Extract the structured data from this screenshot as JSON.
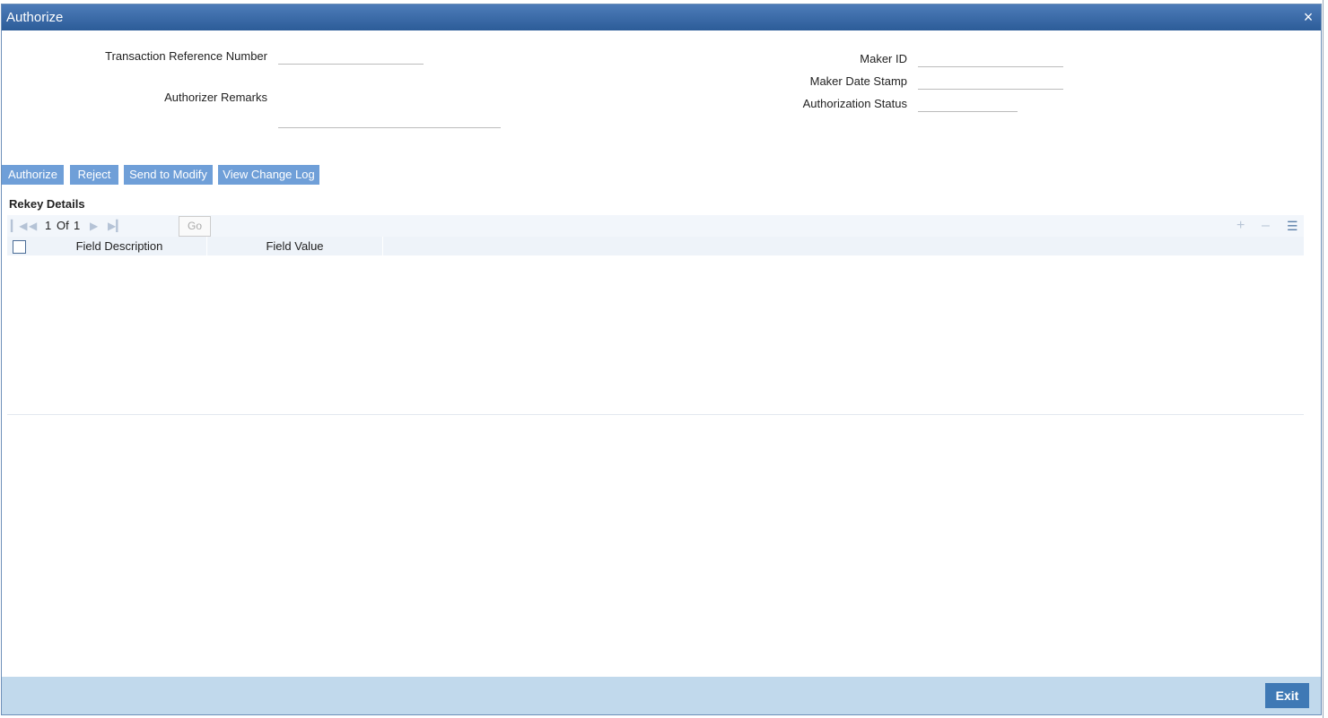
{
  "dialog": {
    "title": "Authorize",
    "close_icon": "×"
  },
  "form": {
    "txn_ref_label": "Transaction Reference Number",
    "txn_ref_value": "",
    "remarks_label": "Authorizer Remarks",
    "remarks_value": "",
    "maker_id_label": "Maker ID",
    "maker_id_value": "",
    "maker_date_label": "Maker Date Stamp",
    "maker_date_value": "",
    "auth_status_label": "Authorization Status",
    "auth_status_value": ""
  },
  "actions": {
    "authorize": "Authorize",
    "reject": "Reject",
    "send_to_modify": "Send to Modify",
    "view_change_log": "View Change Log"
  },
  "rekey": {
    "title": "Rekey Details",
    "page_current": "1",
    "page_of": "Of",
    "page_total": "1",
    "page_input": "",
    "go_label": "Go",
    "columns": [
      "Field Description",
      "Field Value"
    ],
    "rows": []
  },
  "footer": {
    "exit_label": "Exit"
  },
  "icons": {
    "first_page": "first-page-icon",
    "prev_page": "prev-page-icon",
    "next_page": "next-page-icon",
    "last_page": "last-page-icon",
    "add_row": "plus-icon",
    "delete_row": "minus-icon",
    "single_view": "list-view-icon"
  },
  "colors": {
    "titlebar": "#2c5c98",
    "button": "#6f9fd8",
    "footer": "#c1d9ec",
    "exit_button": "#3f79b5"
  }
}
